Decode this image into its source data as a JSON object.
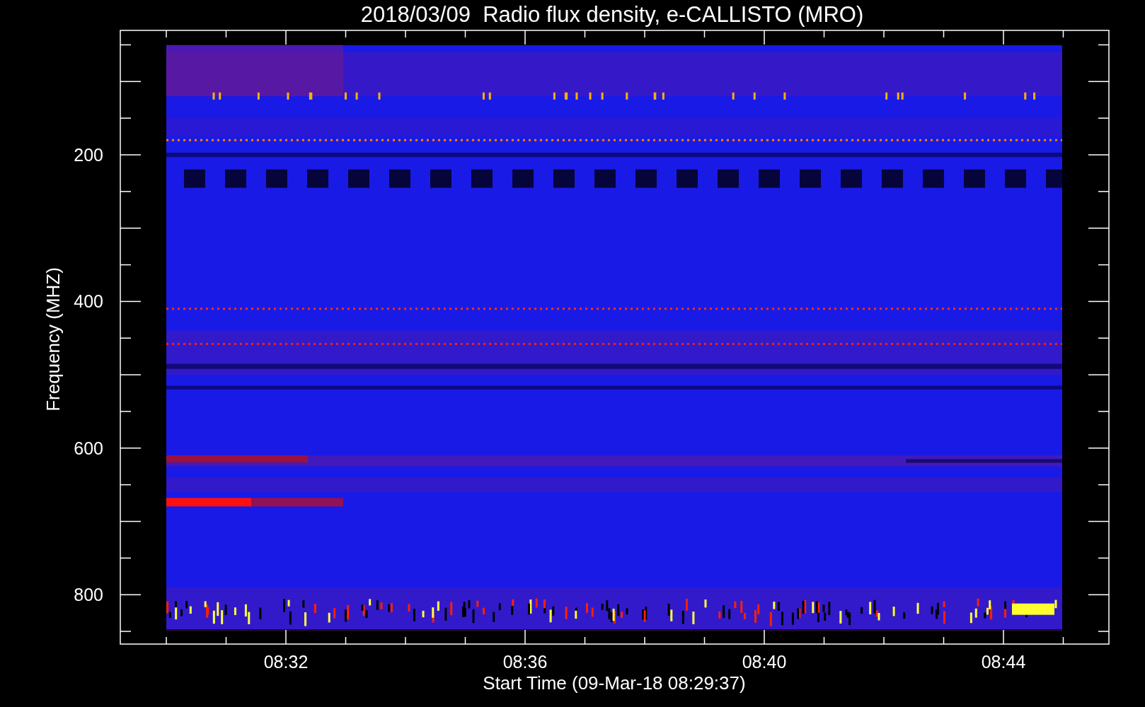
{
  "title": "2018/03/09  Radio flux density, e-CALLISTO (MRO)",
  "y_axis": {
    "label": "Frequency (MHZ)",
    "ticks": [
      "200",
      "400",
      "600",
      "800"
    ]
  },
  "x_axis": {
    "label": "Start Time (09-Mar-18 08:29:37)",
    "ticks": [
      "08:32",
      "08:36",
      "08:40",
      "08:44"
    ]
  }
}
